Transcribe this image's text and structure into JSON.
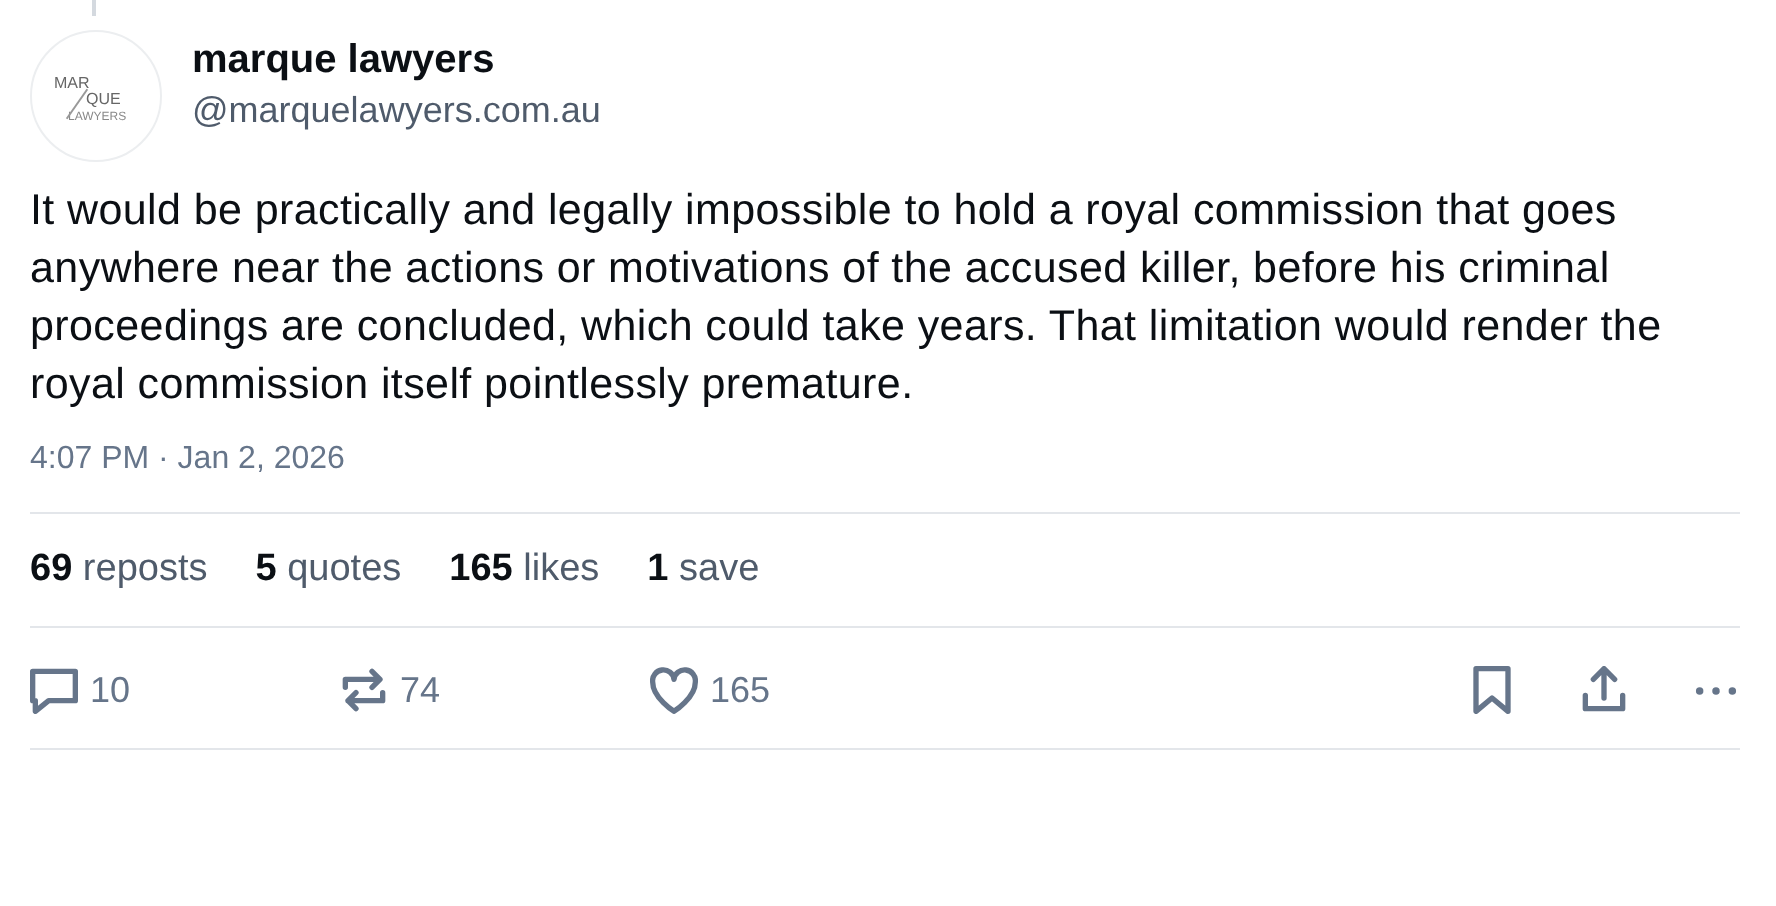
{
  "author": {
    "logo_lines": [
      "MAR",
      "QUE",
      "LAWYERS"
    ],
    "name": "marque lawyers",
    "handle": "@marquelawyers.com.au"
  },
  "text": "It would be practically and legally impossible to hold a royal commission that goes anywhere near the actions or motivations of the accused killer, before his criminal proceedings are concluded, which could take years. That limitation would render the royal commission itself pointlessly premature.",
  "timestamp": "4:07 PM · Jan 2, 2026",
  "stats": [
    {
      "count": "69",
      "label": "reposts"
    },
    {
      "count": "5",
      "label": "quotes"
    },
    {
      "count": "165",
      "label": "likes"
    },
    {
      "count": "1",
      "label": "save"
    }
  ],
  "actions": [
    {
      "kind": "reply",
      "count": "10"
    },
    {
      "kind": "repost",
      "count": "74"
    },
    {
      "kind": "like",
      "count": "165"
    },
    {
      "kind": "bookmark"
    },
    {
      "kind": "share"
    },
    {
      "kind": "more"
    }
  ]
}
